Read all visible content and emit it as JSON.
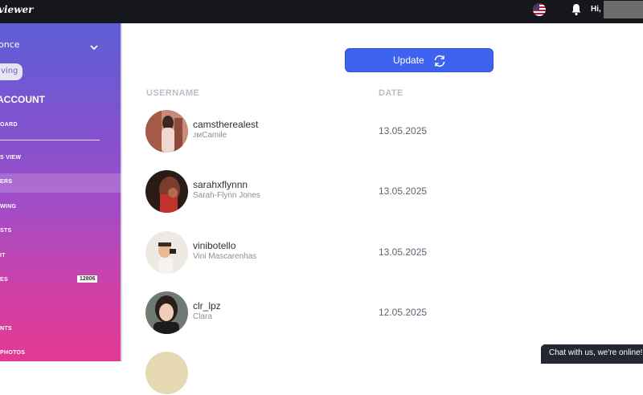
{
  "topbar": {
    "brand": "viewer",
    "greeting": "Hi,"
  },
  "sidebar": {
    "account_selector": "once",
    "pill_label": "ving",
    "section_title": "ACCOUNT",
    "items": [
      {
        "label": "OARD"
      },
      {
        "label": "S VIEW"
      },
      {
        "label": "ERS"
      },
      {
        "label": "WING"
      },
      {
        "label": "STS"
      },
      {
        "label": "IT"
      },
      {
        "label": "ES",
        "badge": "12806"
      },
      {
        "label": "NTS"
      },
      {
        "label": "PHOTOS"
      }
    ]
  },
  "main": {
    "update_label": "Update",
    "columns": {
      "username": "USERNAME",
      "date": "DATE"
    },
    "rows": [
      {
        "username": "camstherealest",
        "name": "ᴊᴍCamile",
        "date": "13.05.2025"
      },
      {
        "username": "sarahxflynnn",
        "name": "Sarah-Flynn Jones",
        "date": "13.05.2025"
      },
      {
        "username": "vinibotello",
        "name": "Vini Mascarenhas",
        "date": "13.05.2025"
      },
      {
        "username": "clr_lpz",
        "name": "Clara",
        "date": "12.05.2025"
      }
    ]
  },
  "chat_label": "Chat with us, we're online!",
  "colors": {
    "accent": "#3d63f0",
    "topbar": "#15171c",
    "sidebar_top": "#5f5fd6",
    "sidebar_bottom": "#e23a93"
  }
}
